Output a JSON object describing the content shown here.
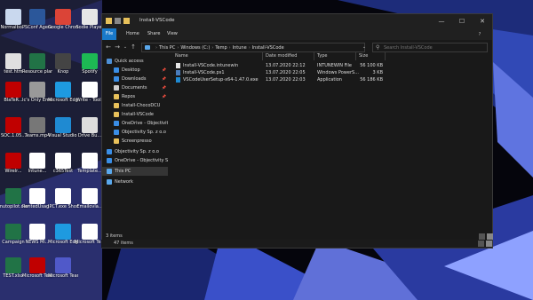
{
  "desktop": {
    "icons": [
      {
        "label": "Normalbo...",
        "color": "#c9d8ee"
      },
      {
        "label": "PSConf Agenda.docx",
        "color": "#2b579a"
      },
      {
        "label": "Google Chrome",
        "color": "#db4437"
      },
      {
        "label": "Sodie Player",
        "color": "#e6e6e6"
      },
      {
        "label": "test.htm",
        "color": "#e0e0e0"
      },
      {
        "label": "Resource plan Hobb...",
        "color": "#217346"
      },
      {
        "label": "Knop",
        "color": "#444444"
      },
      {
        "label": "Spotify",
        "color": "#1db954"
      },
      {
        "label": "BlaTeR...",
        "color": "#c00000"
      },
      {
        "label": "Ic's Only Emotion.mp4",
        "color": "#999999"
      },
      {
        "label": "Microsoft Edge",
        "color": "#1e9ae0"
      },
      {
        "label": "Write - Toolz",
        "color": "#ffffff"
      },
      {
        "label": "SOC.1.05...",
        "color": "#c00000"
      },
      {
        "label": "Teams.mp4",
        "color": "#777777"
      },
      {
        "label": "Visual Studio Code",
        "color": "#1f8ad2"
      },
      {
        "label": "Drive Bu...",
        "color": "#dddddd"
      },
      {
        "label": "Wirelr...",
        "color": "#c00000"
      },
      {
        "label": "Intune...",
        "color": "#ffffff"
      },
      {
        "label": "c365Test",
        "color": "#ffffff"
      },
      {
        "label": "Template...",
        "color": "#ffffff"
      },
      {
        "label": "mutopilot.csv",
        "color": "#217346"
      },
      {
        "label": "RentedUsag...",
        "color": "#ffffff"
      },
      {
        "label": "IPCT.exe Shortcut",
        "color": "#ffffff"
      },
      {
        "label": "Emailovla...",
        "color": "#ffffff"
      },
      {
        "label": "Campaign",
        "color": "#217346"
      },
      {
        "label": "NEWS Mi...",
        "color": "#ffffff"
      },
      {
        "label": "Microsoft Edge",
        "color": "#1e9ae0"
      },
      {
        "label": "Microsoft Teams(O)",
        "color": "#ffffff"
      },
      {
        "label": "TEST.xlsx",
        "color": "#217346"
      },
      {
        "label": "Microsoft Teams",
        "color": "#c00000"
      },
      {
        "label": "Microsoft Teams",
        "color": "#5059c9"
      }
    ]
  },
  "window": {
    "title": "Install-VSCode",
    "controls": {
      "minimize": "—",
      "maximize": "☐",
      "close": "✕"
    },
    "ribbon_tabs": [
      "File",
      "Home",
      "Share",
      "View"
    ],
    "breadcrumb": [
      "This PC",
      "Windows (C:)",
      "Temp",
      "Intune",
      "Install-VSCode"
    ],
    "search_placeholder": "Search Install-VSCode",
    "nav": [
      {
        "label": "Quick access",
        "icon": "star-icon",
        "color": "#4d8fd6",
        "indent": 0,
        "pin": false
      },
      {
        "label": "Desktop",
        "icon": "desktop-icon",
        "color": "#3a8ee6",
        "indent": 1,
        "pin": true
      },
      {
        "label": "Downloads",
        "icon": "download-icon",
        "color": "#3a8ee6",
        "indent": 1,
        "pin": true
      },
      {
        "label": "Documents",
        "icon": "document-icon",
        "color": "#cfcfcf",
        "indent": 1,
        "pin": true
      },
      {
        "label": "Repos",
        "icon": "folder-icon",
        "color": "#e8c15a",
        "indent": 1,
        "pin": true
      },
      {
        "label": "Install-ChocoDCU",
        "icon": "folder-icon",
        "color": "#e8c15a",
        "indent": 1,
        "pin": false
      },
      {
        "label": "Install-VSCode",
        "icon": "folder-icon",
        "color": "#e8c15a",
        "indent": 1,
        "pin": false
      },
      {
        "label": "OneDrive - Objectivity Sp.",
        "icon": "cloud-icon",
        "color": "#3a8ee6",
        "indent": 1,
        "pin": false
      },
      {
        "label": "Objectivity Sp. z o.o",
        "icon": "cloud-icon",
        "color": "#3a8ee6",
        "indent": 1,
        "pin": false
      },
      {
        "label": "Screenpresso",
        "icon": "folder-icon",
        "color": "#e8c15a",
        "indent": 1,
        "pin": false
      },
      {
        "label": "Objectivity Sp. z o.o",
        "icon": "building-icon",
        "color": "#3a8ee6",
        "indent": 0,
        "pin": false
      },
      {
        "label": "OneDrive - Objectivity Sp. z o",
        "icon": "cloud-icon",
        "color": "#3a8ee6",
        "indent": 0,
        "pin": false
      },
      {
        "label": "This PC",
        "icon": "pc-icon",
        "color": "#5aa8ec",
        "indent": 0,
        "pin": false
      },
      {
        "label": "Network",
        "icon": "network-icon",
        "color": "#5aa8ec",
        "indent": 0,
        "pin": false
      }
    ],
    "columns": [
      "Name",
      "Date modified",
      "Type",
      "Size"
    ],
    "files": [
      {
        "name": "Install-VSCode.intunewin",
        "date": "13.07.2020 22:12",
        "type": "INTUNEWIN File",
        "size": "56 100 KB",
        "color": "#e6e6e6"
      },
      {
        "name": "Install-VSCode.ps1",
        "date": "13.07.2020 22:05",
        "type": "Windows PowerS...",
        "size": "3 KB",
        "color": "#4a7dbd"
      },
      {
        "name": "VSCodeUserSetup-x64-1.47.0.exe",
        "date": "13.07.2020 22:03",
        "type": "Application",
        "size": "56 186 KB",
        "color": "#1f8ad2"
      }
    ],
    "status": "3 items"
  },
  "taskbar_text": "47 items"
}
